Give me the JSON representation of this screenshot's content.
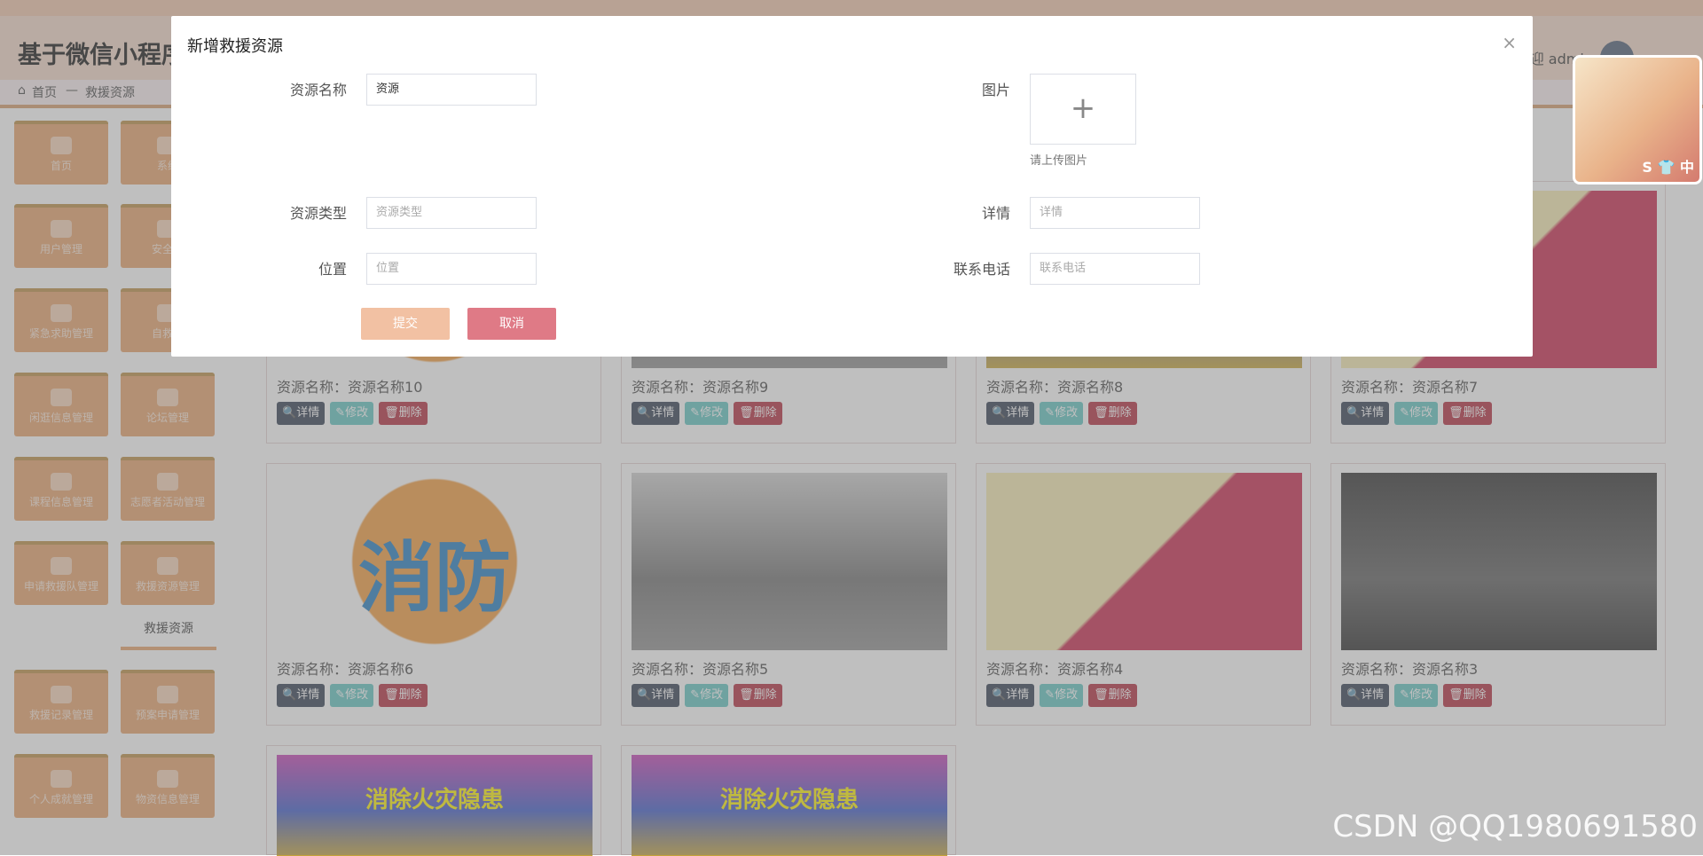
{
  "header": {
    "title": "基于微信小程序的",
    "welcome": "欢迎 admin"
  },
  "breadcrumb": {
    "home": "首页",
    "sep": "—",
    "current": "救援资源"
  },
  "sidebar": {
    "items": [
      "首页",
      "系统",
      "用户管理",
      "安全知",
      "紧急求助管理",
      "自救自",
      "闲逛信息管理",
      "论坛管理",
      "课程信息管理",
      "志愿者活动管理",
      "申请救援队管理",
      "救援资源管理",
      "救援记录管理",
      "预案申请管理",
      "个人成就管理",
      "物资信息管理"
    ],
    "active_sub": "救援资源"
  },
  "cards": [
    {
      "name_label": "资源名称：",
      "name": "资源名称10"
    },
    {
      "name_label": "资源名称：",
      "name": "资源名称9"
    },
    {
      "name_label": "资源名称：",
      "name": "资源名称8"
    },
    {
      "name_label": "资源名称：",
      "name": "资源名称7"
    },
    {
      "name_label": "资源名称：",
      "name": "资源名称6",
      "img_text": "消防"
    },
    {
      "name_label": "资源名称：",
      "name": "资源名称5"
    },
    {
      "name_label": "资源名称：",
      "name": "资源名称4"
    },
    {
      "name_label": "资源名称：",
      "name": "资源名称3"
    },
    {
      "img_text": "消除火灾隐患"
    },
    {
      "img_text": "消除火灾隐患"
    }
  ],
  "card_buttons": {
    "detail": "详情",
    "edit": "修改",
    "delete": "删除"
  },
  "dialog": {
    "title": "新增救援资源",
    "close": "×",
    "fields": {
      "name": {
        "label": "资源名称",
        "value": "资源"
      },
      "image": {
        "label": "图片",
        "hint": "请上传图片"
      },
      "type": {
        "label": "资源类型",
        "placeholder": "资源类型"
      },
      "detail": {
        "label": "详情",
        "placeholder": "详情"
      },
      "location": {
        "label": "位置",
        "placeholder": "位置"
      },
      "phone": {
        "label": "联系电话",
        "placeholder": "联系电话"
      }
    },
    "submit": "提交",
    "cancel": "取消"
  },
  "float_badge": "S 👕 中",
  "watermark": "CSDN @QQ1980691580"
}
